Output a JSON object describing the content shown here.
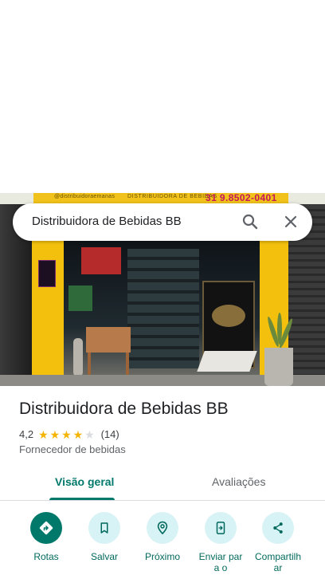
{
  "photo": {
    "sign_left_text": "@distribuidoraemanas",
    "sign_center_text": "DISTRIBUIDORA DE BEBIDAS",
    "sign_phone": "31 9.8502-0401"
  },
  "search": {
    "query": "Distribuidora de Bebidas BB",
    "search_icon": "search-icon",
    "close_icon": "close-icon"
  },
  "place": {
    "name": "Distribuidora de Bebidas BB",
    "rating": "4,2",
    "rating_fraction": 0.84,
    "review_count": "(14)",
    "category": "Fornecedor de bebidas"
  },
  "tabs": [
    {
      "label": "Visão geral",
      "active": true
    },
    {
      "label": "Avaliações",
      "active": false
    }
  ],
  "actions": [
    {
      "label": "Rotas",
      "icon": "directions-icon"
    },
    {
      "label": "Salvar",
      "icon": "bookmark-icon"
    },
    {
      "label": "Próximo",
      "icon": "nearby-icon"
    },
    {
      "label": "Enviar para o",
      "icon": "send-to-phone-icon"
    },
    {
      "label": "Compartilhar",
      "icon": "share-icon"
    }
  ],
  "colors": {
    "accent": "#00796b",
    "action_bg": "#d8f3f6",
    "star": "#f4b400"
  }
}
